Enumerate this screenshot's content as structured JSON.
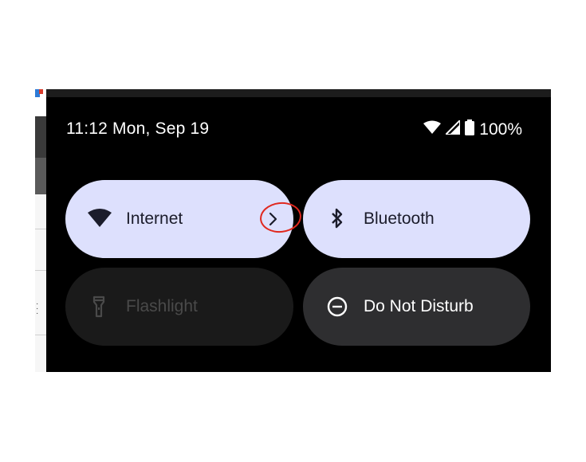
{
  "status_bar": {
    "time_date": "11:12 Mon, Sep 19",
    "battery_percent": "100%",
    "wifi_icon": "wifi-icon",
    "signal_icon": "cell-signal-icon",
    "battery_icon": "battery-icon"
  },
  "tiles": [
    {
      "label": "Internet",
      "state": "on",
      "icon": "wifi-icon",
      "has_chevron": true
    },
    {
      "label": "Bluetooth",
      "state": "on",
      "icon": "bluetooth-icon"
    },
    {
      "label": "Flashlight",
      "state": "unavailable",
      "icon": "flashlight-icon"
    },
    {
      "label": "Do Not Disturb",
      "state": "off",
      "icon": "do-not-disturb-icon"
    }
  ],
  "colors": {
    "shade_background": "#000000",
    "tile_on": "#dde0fd",
    "tile_off": "#2e2e30",
    "tile_unavailable": "#1a1a1a",
    "annotation_red": "#e0281f"
  }
}
